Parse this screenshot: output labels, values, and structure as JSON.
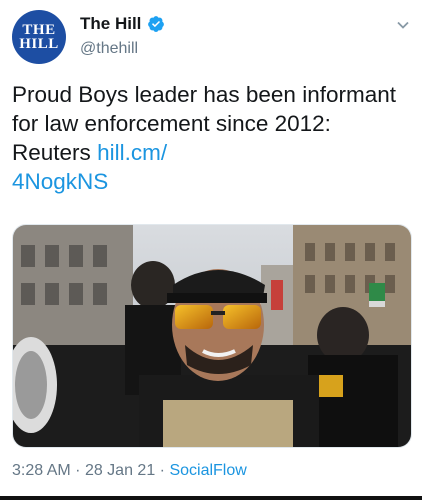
{
  "account": {
    "name": "The Hill",
    "handle": "@thehill",
    "avatar_line1": "THE",
    "avatar_line2": "HILL"
  },
  "tweet": {
    "text": "Proud Boys leader has been informant for law enforcement since 2012: Reuters",
    "link_line1": "hill.cm/",
    "link_line2": "4NogkNS"
  },
  "meta": {
    "time": "3:28 AM",
    "separator": "·",
    "date": "28 Jan 21",
    "source": "SocialFlow"
  },
  "colors": {
    "accent": "#1b95e0",
    "avatar_bg": "#1d4ea3",
    "secondary_text": "#657786"
  },
  "icons": [
    "verified-badge-icon",
    "chevron-down-icon"
  ]
}
